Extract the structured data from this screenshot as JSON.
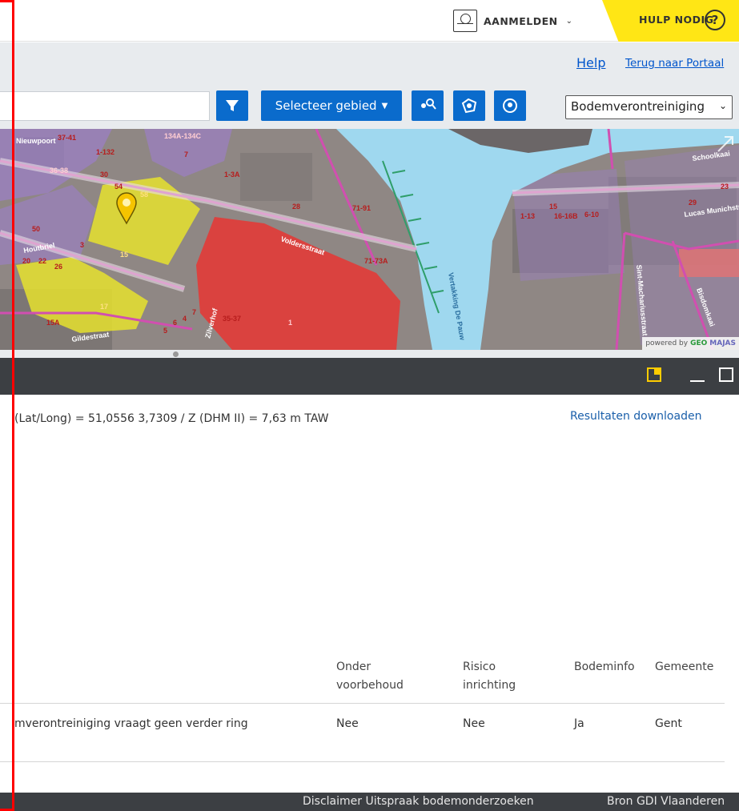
{
  "header": {
    "login_label": "AANMELDEN",
    "help_label": "HULP NODIG",
    "help_icon": "?"
  },
  "links": {
    "help": "Help",
    "portal": "Terug naar Portaal"
  },
  "toolbar": {
    "search_value": "",
    "select_area_label": "Selecteer gebied",
    "layer_selected": "Bodemverontreiniging"
  },
  "map": {
    "streets": [
      "Nieuwpoort",
      "Voldersstraat",
      "Houtbriel",
      "Gildestraat",
      "Zilverhof",
      "Vertakking De Pauw",
      "Schoolkaai",
      "Lucas Munichstraat",
      "Sint-Machariusstraat",
      "Bisdomkaai"
    ],
    "labels": [
      "37-41",
      "134A-134C",
      "1-132",
      "36-38",
      "30",
      "54",
      "58",
      "15",
      "17",
      "1-3A",
      "28",
      "50",
      "3",
      "20",
      "22",
      "26",
      "15A",
      "5",
      "6",
      "4",
      "7",
      "1-13",
      "15",
      "16-16B",
      "6-10",
      "29",
      "23",
      "7",
      "71-73A",
      "35-37",
      "71-91",
      "1"
    ],
    "attribution_prefix": "powered by",
    "attribution_brand_a": "GEO",
    "attribution_brand_b": "MAJAS"
  },
  "results": {
    "coordinates_text": "(Lat/Long) = 51,0556 3,7309 / Z (DHM II) = 7,63 m TAW",
    "download_label": "Resultaten downloaden",
    "columns": {
      "onder_voorbehoud": "Onder voorbehoud",
      "risico_inrichting": "Risico inrichting",
      "bodeminfo": "Bodeminfo",
      "gemeente": "Gemeente"
    },
    "row": {
      "description": "mverontreiniging vraagt geen verder ring",
      "onder_voorbehoud": "Nee",
      "risico_inrichting": "Nee",
      "bodeminfo": "Ja",
      "gemeente": "Gent"
    }
  },
  "footer": {
    "disclaimer": "Disclaimer Uitspraak bodemonderzoeken",
    "source": "Bron GDI Vlaanderen"
  },
  "colors": {
    "primary_button": "#0a6bcc",
    "help_yellow": "#ffe615",
    "panel_dark": "#3c3f43",
    "water": "#9fd8ef",
    "contaminated_red": "#e53935",
    "contaminated_yellow": "#e6e22e",
    "parcel_purple": "#9b7fc4",
    "frame_red": "#ff0000"
  }
}
